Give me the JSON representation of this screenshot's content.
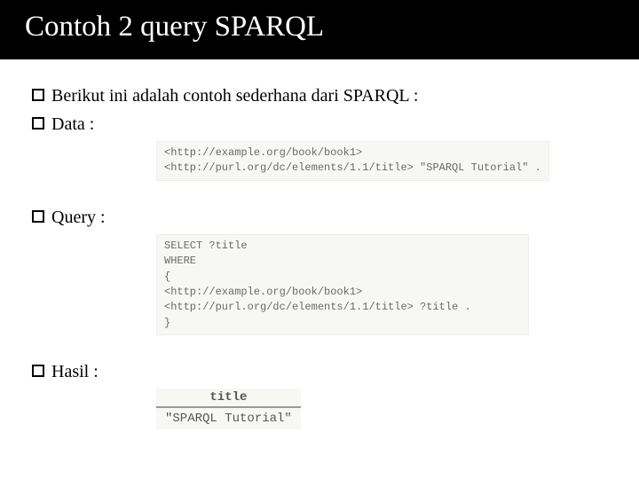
{
  "slide": {
    "title": "Contoh 2 query SPARQL",
    "bullets": {
      "intro": "Berikut ini adalah contoh sederhana dari SPARQL :",
      "data_label": "Data :",
      "query_label": "Query :",
      "result_label": "Hasil :"
    },
    "code": {
      "data": "<http://example.org/book/book1>\n<http://purl.org/dc/elements/1.1/title> \"SPARQL Tutorial\" .",
      "query": "SELECT ?title\nWHERE\n{\n<http://example.org/book/book1>\n<http://purl.org/dc/elements/1.1/title> ?title .\n}"
    },
    "result": {
      "header": "title",
      "row": "\"SPARQL Tutorial\""
    }
  }
}
